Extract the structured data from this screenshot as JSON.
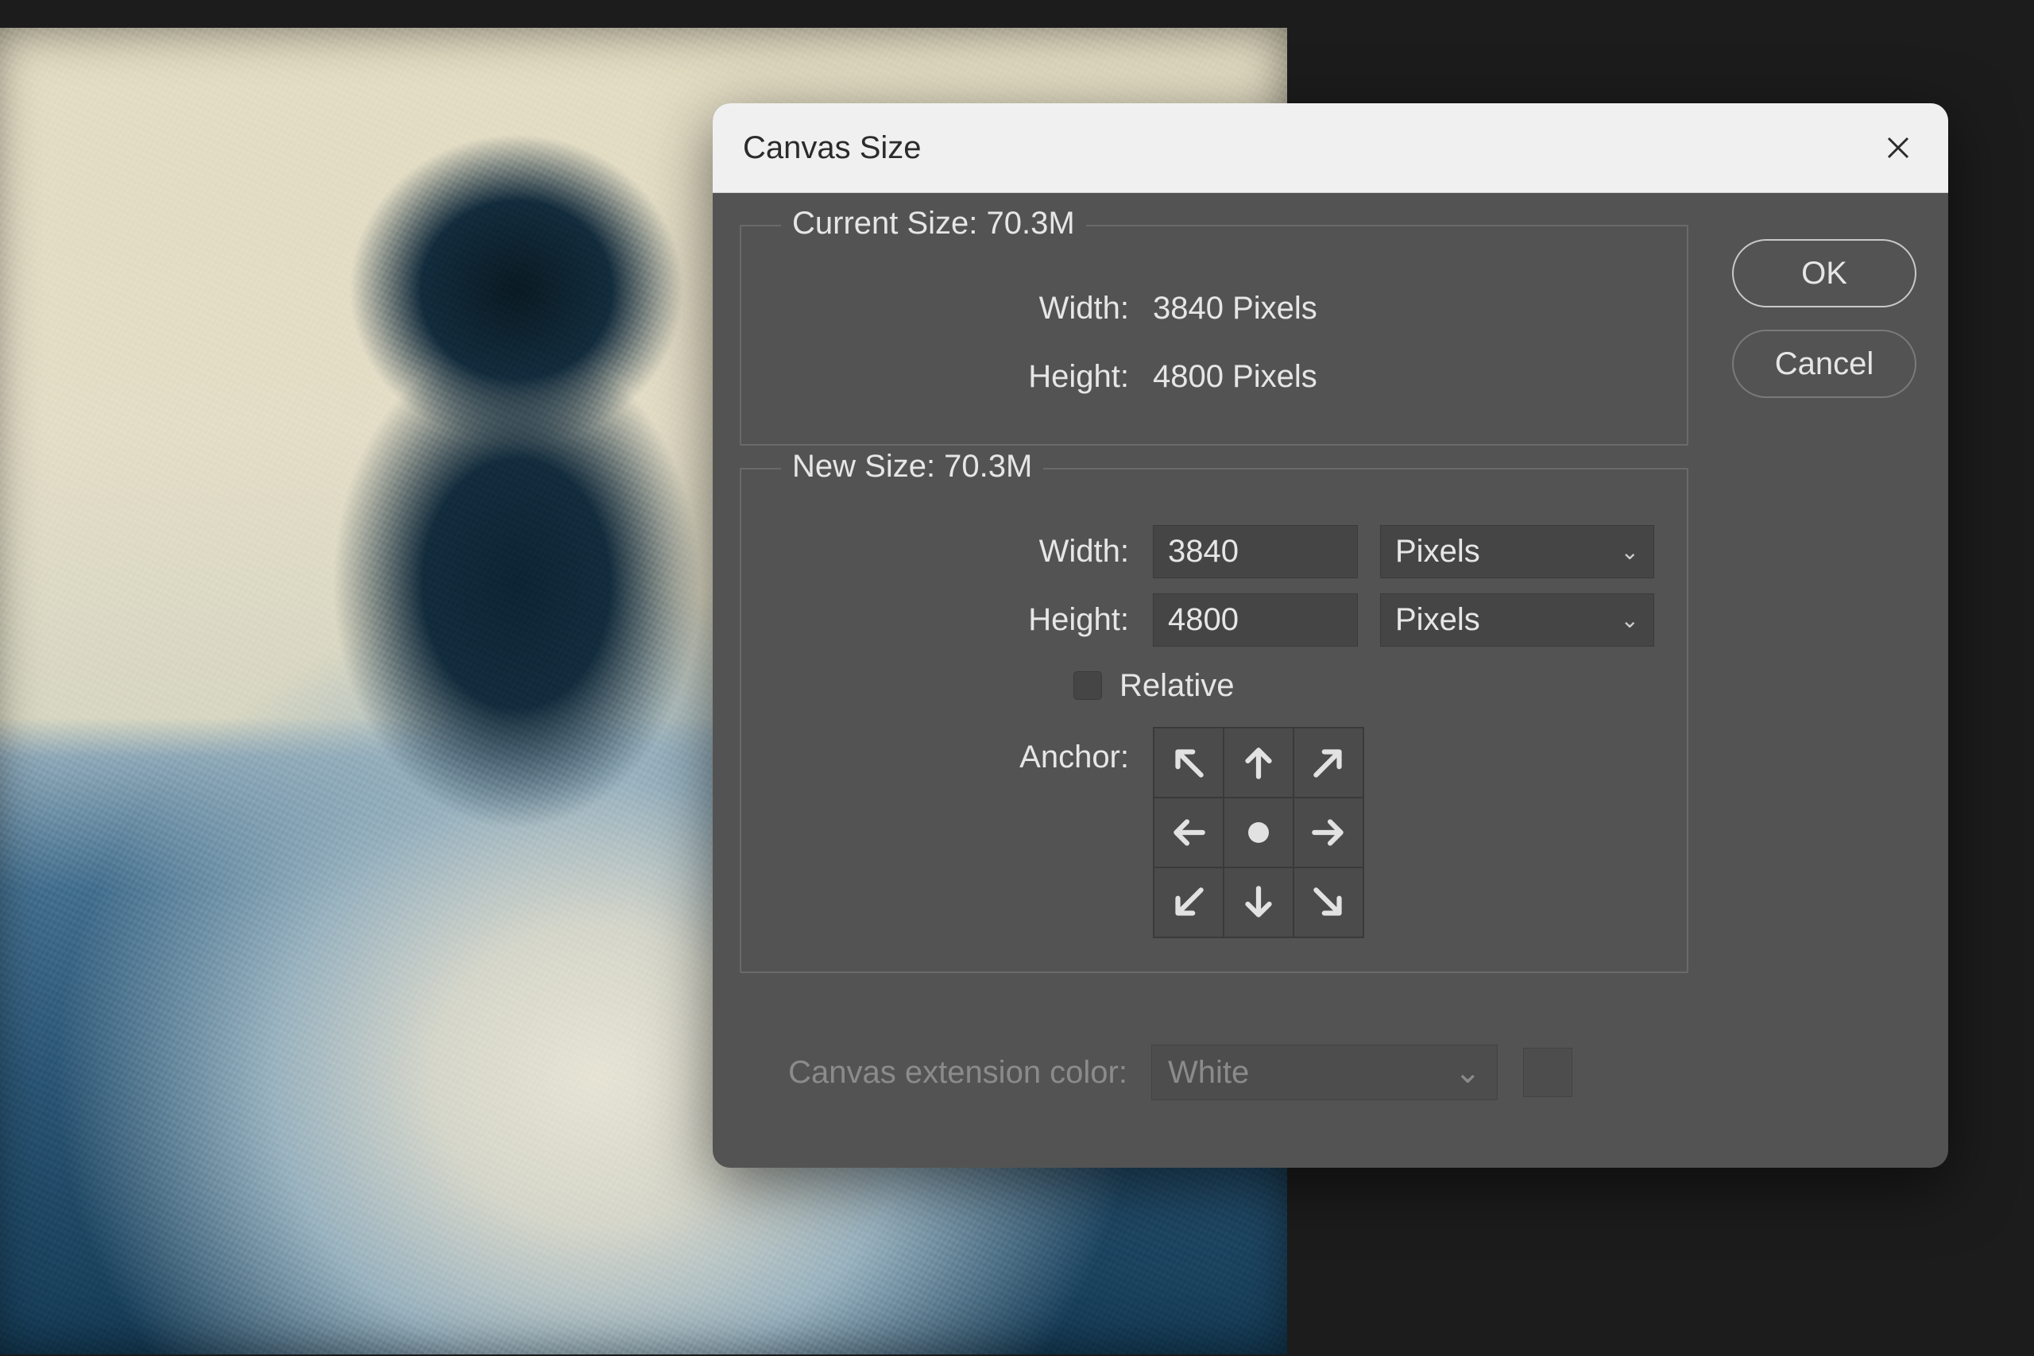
{
  "dialog": {
    "title": "Canvas Size",
    "ok_label": "OK",
    "cancel_label": "Cancel"
  },
  "current": {
    "legend_prefix": "Current Size: ",
    "size_value": "70.3M",
    "width_label": "Width:",
    "width_value": "3840 Pixels",
    "height_label": "Height:",
    "height_value": "4800 Pixels"
  },
  "newsize": {
    "legend_prefix": "New Size: ",
    "size_value": "70.3M",
    "width_label": "Width:",
    "width_value": "3840",
    "width_unit": "Pixels",
    "height_label": "Height:",
    "height_value": "4800",
    "height_unit": "Pixels",
    "relative_label": "Relative",
    "anchor_label": "Anchor:"
  },
  "extension": {
    "label": "Canvas extension color:",
    "value": "White"
  }
}
